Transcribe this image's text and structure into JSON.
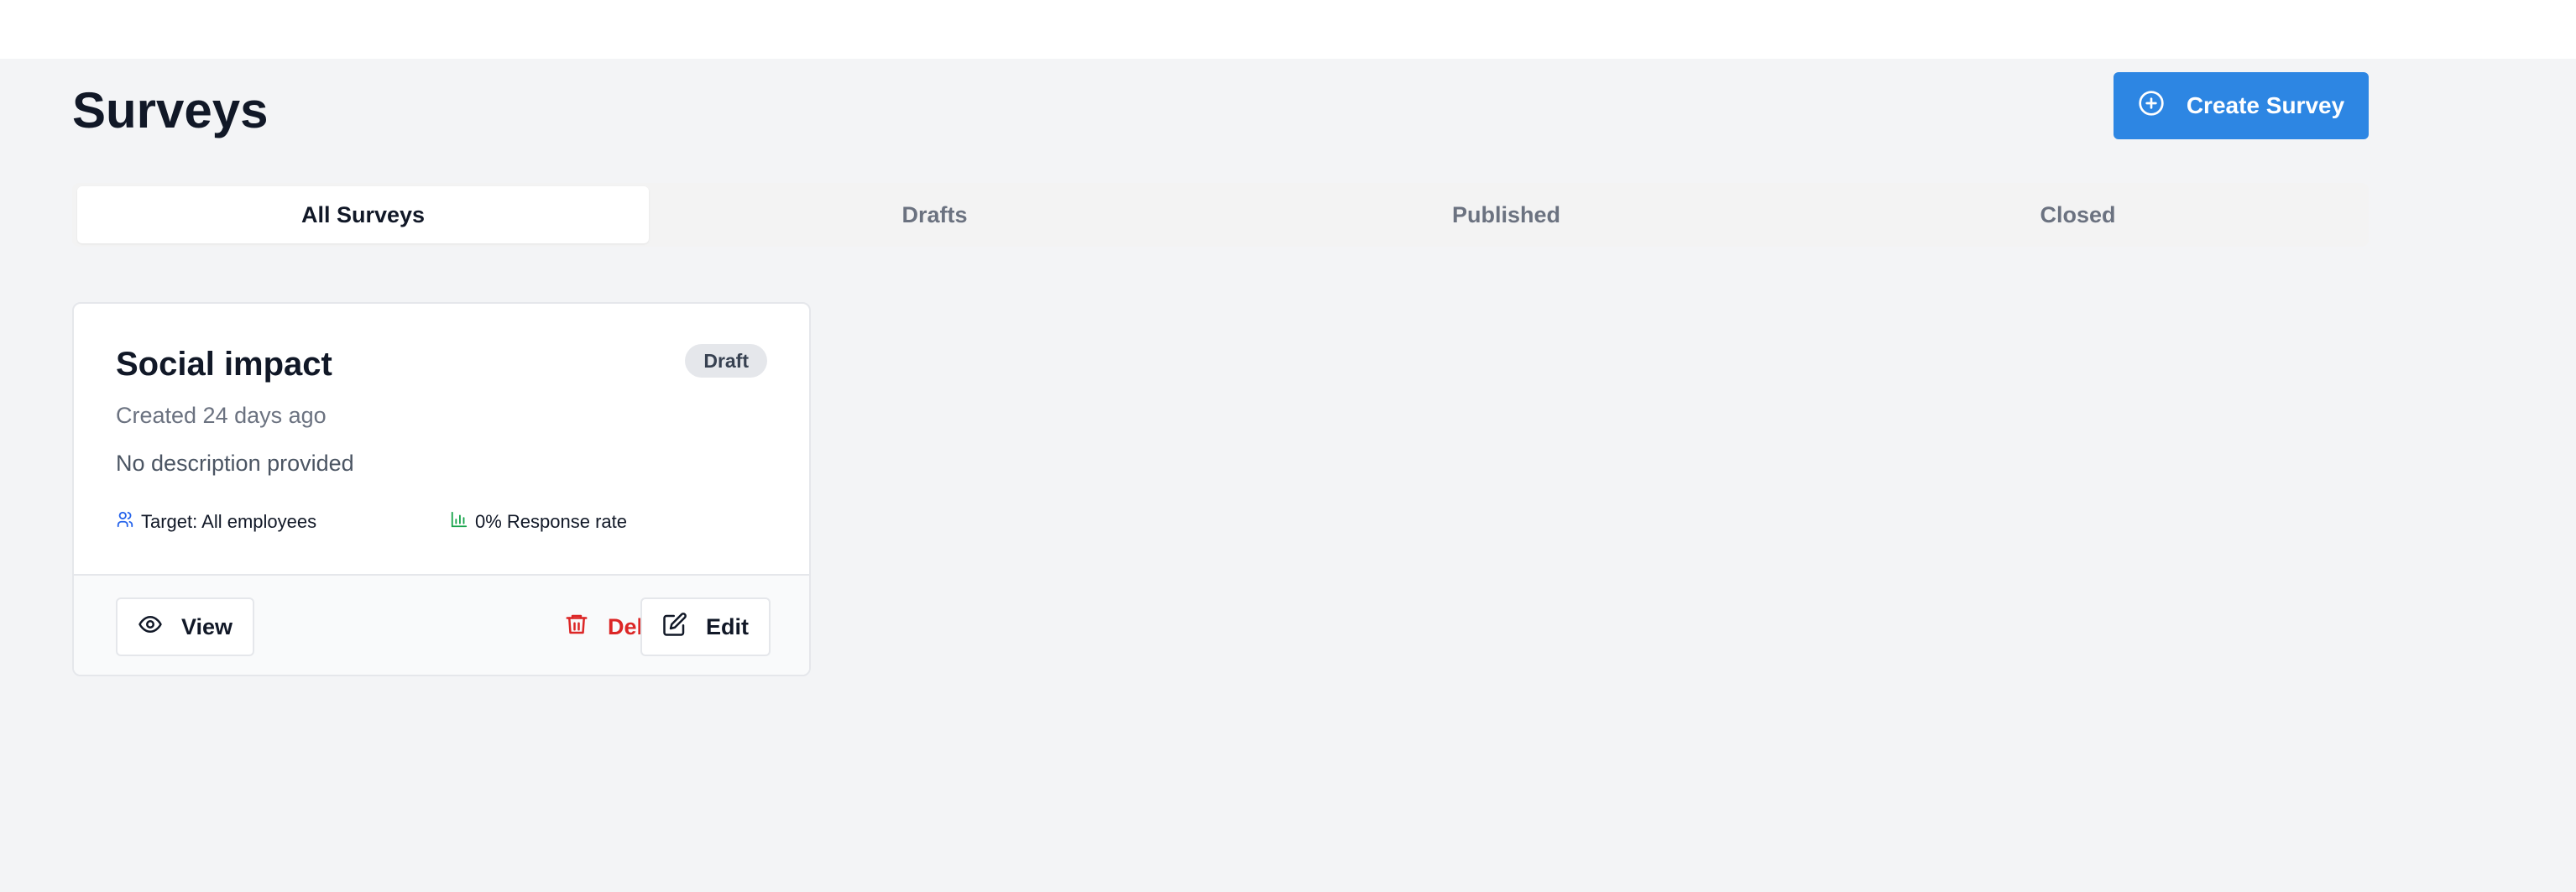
{
  "page": {
    "title": "Surveys"
  },
  "actions": {
    "create_label": "Create Survey"
  },
  "tabs": [
    {
      "label": "All Surveys",
      "active": true
    },
    {
      "label": "Drafts",
      "active": false
    },
    {
      "label": "Published",
      "active": false
    },
    {
      "label": "Closed",
      "active": false
    }
  ],
  "surveys": [
    {
      "title": "Social impact",
      "status": "Draft",
      "created": "Created 24 days ago",
      "description": "No description provided",
      "target": "Target: All employees",
      "response_rate": "0% Response rate",
      "view_label": "View",
      "delete_label": "Delete",
      "edit_label": "Edit"
    }
  ],
  "colors": {
    "primary": "#2d86e3",
    "danger": "#dc2626",
    "background": "#f3f4f6",
    "target_icon": "#2563eb",
    "chart_icon": "#16a34a"
  },
  "icons": {
    "create": "plus-circle-icon",
    "target": "users-icon",
    "response": "bar-chart-icon",
    "view": "eye-icon",
    "delete": "trash-icon",
    "edit": "edit-icon"
  }
}
